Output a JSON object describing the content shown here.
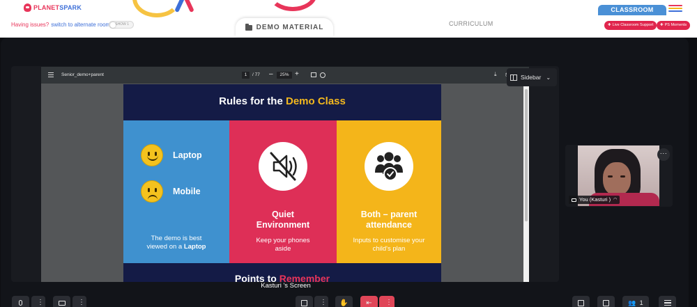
{
  "header": {
    "logo_text_a": "PLANET",
    "logo_text_b": "SPARK",
    "issues_text": "Having issues?",
    "issues_link": "switch to alternate room",
    "toggle_label": "SHOW 1",
    "demo_tab": "DEMO MATERIAL",
    "curriculum_tab": "CURRICULUM",
    "classroom_tag": "CLASSROOM",
    "live_support": "Live Classroom Support",
    "ps_moments": "PS Moments"
  },
  "viewer": {
    "file_name": "Senior_demo+parent",
    "page_current": "1",
    "page_total": "/ 77",
    "zoom": "25%",
    "sidebar_label": "Sidebar"
  },
  "slide": {
    "title_a": "Rules for the ",
    "title_b": "Demo Class",
    "laptop": "Laptop",
    "mobile": "Mobile",
    "blue_sub_a": "The demo is best",
    "blue_sub_b": "viewed on a ",
    "blue_sub_bold": "Laptop",
    "red_heading_a": "Quiet",
    "red_heading_b": "Environment",
    "red_sub_a": "Keep your phones",
    "red_sub_b": "aside",
    "yellow_heading_a": "Both – parent",
    "yellow_heading_b": "attendance",
    "yellow_sub_a": "Inputs to customise your",
    "yellow_sub_b": "child's plan",
    "points_a": "Points to ",
    "points_b": "Remember"
  },
  "screen_label": "Kasturi 's Screen",
  "self_view": {
    "name": "You (Kasturi )"
  },
  "controls": {
    "participants_count": "1"
  },
  "colors": {
    "brand_red": "#e8355a",
    "brand_blue": "#3d6fd8",
    "slide_navy": "#141b46",
    "slide_blue": "#3f91cf",
    "slide_red": "#de2f57",
    "slide_yellow": "#f4b51a",
    "leave_red": "#e04658"
  }
}
